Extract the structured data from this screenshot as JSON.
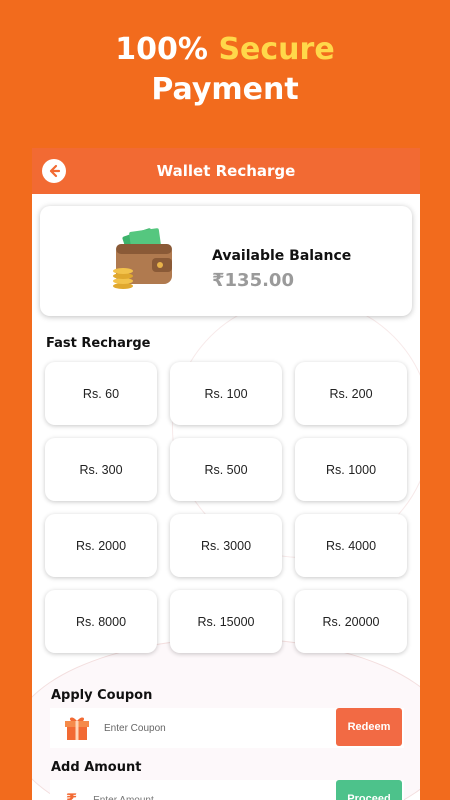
{
  "promo": {
    "line1_prefix": "100%",
    "line1_highlight": "Secure",
    "line2": "Payment",
    "highlight_color": "#ffd84a",
    "background_color": "#f26b1d"
  },
  "appbar": {
    "title": "Wallet Recharge",
    "back_icon": "arrow-left-icon",
    "color": "#f26a33"
  },
  "balance": {
    "label": "Available Balance",
    "value": "₹135.00",
    "icon": "wallet-icon"
  },
  "fast_recharge": {
    "label": "Fast Recharge",
    "amounts": [
      "Rs. 60",
      "Rs. 100",
      "Rs. 200",
      "Rs. 300",
      "Rs. 500",
      "Rs. 1000",
      "Rs. 2000",
      "Rs. 3000",
      "Rs. 4000",
      "Rs. 8000",
      "Rs. 15000",
      "Rs. 20000"
    ]
  },
  "coupon": {
    "label": "Apply Coupon",
    "placeholder": "Enter Coupon",
    "button": "Redeem",
    "icon": "gift-icon"
  },
  "add_amount": {
    "label": "Add Amount",
    "placeholder": "Enter Amount",
    "button": "Proceed",
    "icon": "rupee-icon"
  }
}
